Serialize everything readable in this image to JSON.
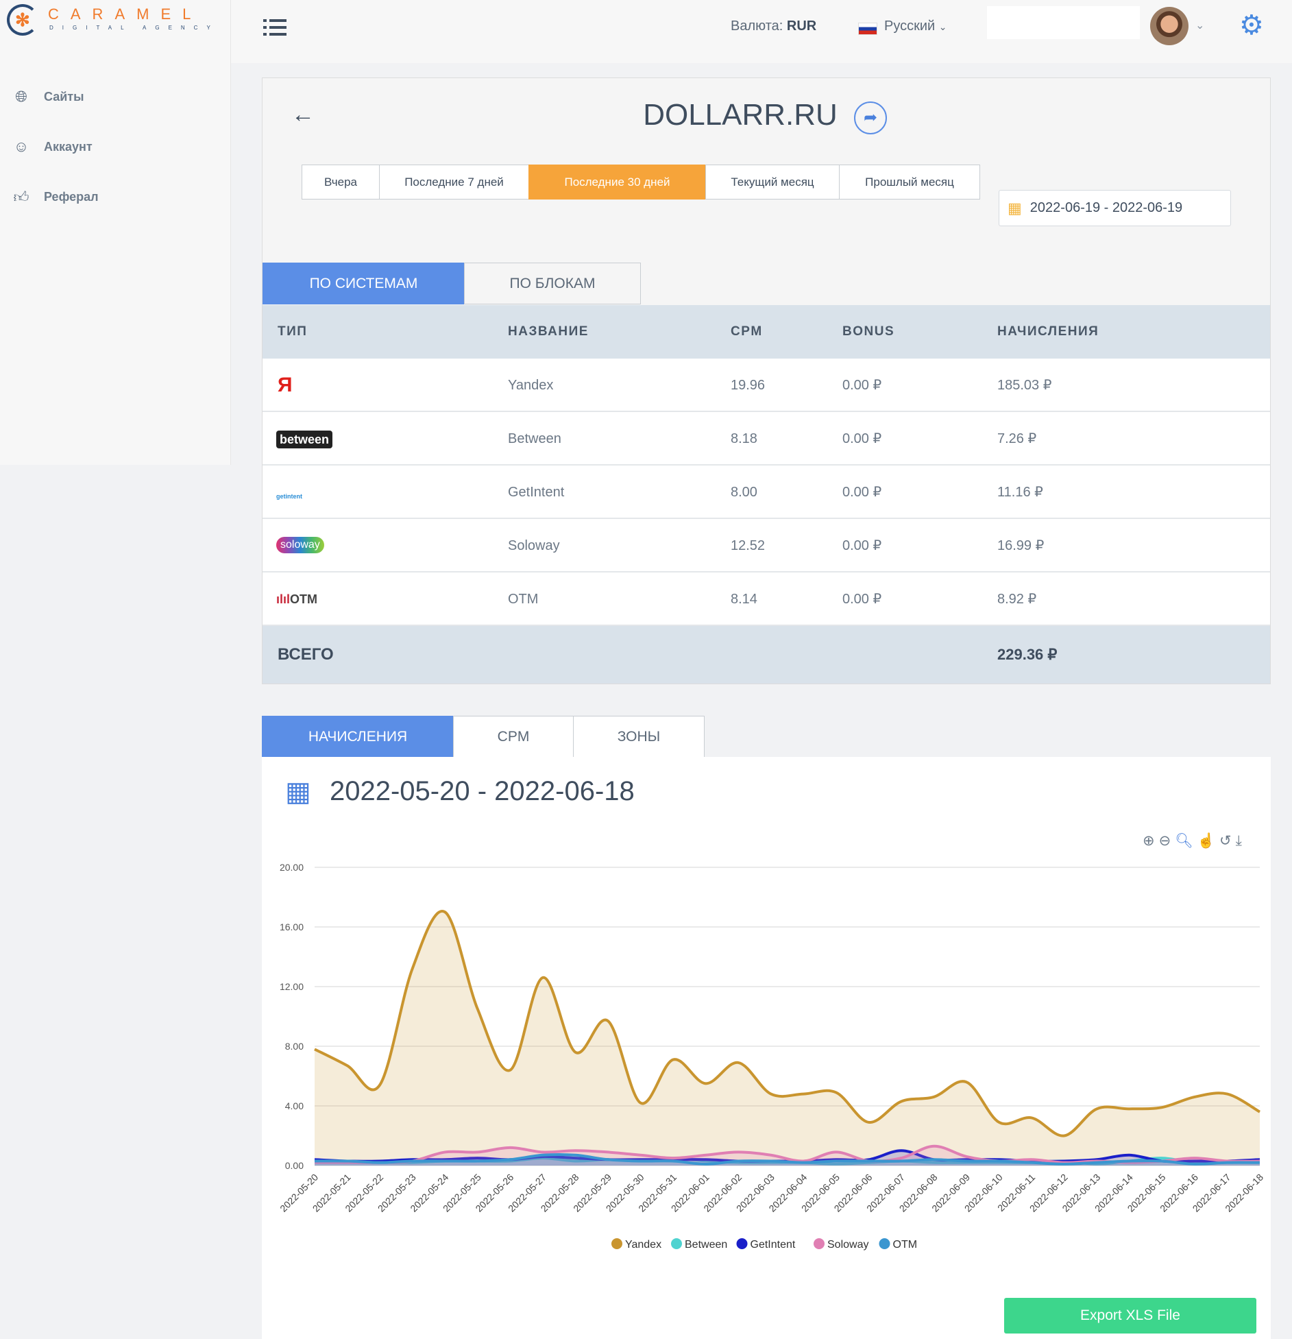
{
  "brand": {
    "name": "CARAMEL",
    "tagline": "DIGITAL AGENCY"
  },
  "sidebar": {
    "items": [
      {
        "label": "Сайты",
        "icon": "globe-icon"
      },
      {
        "label": "Аккаунт",
        "icon": "user-icon"
      },
      {
        "label": "Реферал",
        "icon": "referral-icon"
      }
    ]
  },
  "header": {
    "currency_label": "Валюта:",
    "currency": "RUR",
    "language": "Русский"
  },
  "site": {
    "title": "DOLLARR.RU"
  },
  "periods": [
    {
      "label": "Вчера"
    },
    {
      "label": "Последние 7 дней"
    },
    {
      "label": "Последние 30 дней",
      "active": true
    },
    {
      "label": "Текущий месяц"
    },
    {
      "label": "Прошлый месяц"
    }
  ],
  "date_range": "2022-06-19 - 2022-06-19",
  "view_tabs": [
    "ПО СИСТЕМАМ",
    "ПО БЛОКАМ"
  ],
  "table": {
    "headers": [
      "ТИП",
      "НАЗВАНИЕ",
      "CPM",
      "BONUS",
      "НАЧИСЛЕНИЯ"
    ],
    "rows": [
      {
        "logo": "Я",
        "name": "Yandex",
        "cpm": "19.96",
        "bonus": "0.00 ₽",
        "earn": "185.03 ₽"
      },
      {
        "logo": "between",
        "name": "Between",
        "cpm": "8.18",
        "bonus": "0.00 ₽",
        "earn": "7.26 ₽"
      },
      {
        "logo": "getintent",
        "name": "GetIntent",
        "cpm": "8.00",
        "bonus": "0.00 ₽",
        "earn": "11.16 ₽"
      },
      {
        "logo": "soloway",
        "name": "Soloway",
        "cpm": "12.52",
        "bonus": "0.00 ₽",
        "earn": "16.99 ₽"
      },
      {
        "logo": "OTM",
        "name": "OTM",
        "cpm": "8.14",
        "bonus": "0.00 ₽",
        "earn": "8.92 ₽"
      }
    ],
    "total_label": "ВСЕГО",
    "total": "229.36 ₽"
  },
  "chart_tabs": [
    "НАЧИСЛЕНИЯ",
    "CPM",
    "ЗОНЫ"
  ],
  "chart_range": "2022-05-20 - 2022-06-18",
  "export_label": "Export XLS File",
  "chart_data": {
    "type": "area",
    "x": [
      "2022-05-20",
      "2022-05-21",
      "2022-05-22",
      "2022-05-23",
      "2022-05-24",
      "2022-05-25",
      "2022-05-26",
      "2022-05-27",
      "2022-05-28",
      "2022-05-29",
      "2022-05-30",
      "2022-05-31",
      "2022-06-01",
      "2022-06-02",
      "2022-06-03",
      "2022-06-04",
      "2022-06-05",
      "2022-06-06",
      "2022-06-07",
      "2022-06-08",
      "2022-06-09",
      "2022-06-10",
      "2022-06-11",
      "2022-06-12",
      "2022-06-13",
      "2022-06-14",
      "2022-06-15",
      "2022-06-16",
      "2022-06-17",
      "2022-06-18"
    ],
    "ylim": [
      0,
      20
    ],
    "yticks": [
      "0.00",
      "4.00",
      "8.00",
      "12.00",
      "16.00",
      "20.00"
    ],
    "legend_position": "bottom",
    "series": [
      {
        "name": "Yandex",
        "color": "#c9952f",
        "values": [
          7.8,
          6.7,
          5.4,
          13.2,
          17.0,
          10.5,
          6.4,
          12.6,
          7.6,
          9.7,
          4.2,
          7.1,
          5.5,
          6.9,
          4.8,
          4.8,
          4.9,
          2.9,
          4.3,
          4.6,
          5.6,
          2.9,
          3.2,
          2.0,
          3.8,
          3.8,
          3.9,
          4.6,
          4.8,
          3.6
        ]
      },
      {
        "name": "Between",
        "color": "#4fd3d0",
        "values": [
          0.2,
          0.2,
          0.2,
          0.2,
          0.3,
          0.3,
          0.3,
          0.5,
          0.3,
          0.4,
          0.3,
          0.5,
          0.3,
          0.2,
          0.2,
          0.2,
          0.1,
          0.2,
          0.3,
          0.2,
          0.2,
          0.2,
          0.2,
          0.3,
          0.1,
          0.3,
          0.5,
          0.2,
          0.2,
          0.2
        ]
      },
      {
        "name": "GetIntent",
        "color": "#1a1fc9",
        "values": [
          0.4,
          0.3,
          0.3,
          0.4,
          0.4,
          0.5,
          0.4,
          0.6,
          0.5,
          0.4,
          0.4,
          0.4,
          0.4,
          0.3,
          0.3,
          0.3,
          0.4,
          0.4,
          1.0,
          0.4,
          0.4,
          0.4,
          0.3,
          0.3,
          0.4,
          0.7,
          0.3,
          0.3,
          0.3,
          0.4
        ]
      },
      {
        "name": "Soloway",
        "color": "#e07fb3",
        "values": [
          0.2,
          0.2,
          0.2,
          0.3,
          0.9,
          0.9,
          1.2,
          0.9,
          1.0,
          0.9,
          0.7,
          0.5,
          0.7,
          0.9,
          0.7,
          0.3,
          0.9,
          0.3,
          0.5,
          1.3,
          0.6,
          0.3,
          0.4,
          0.2,
          0.3,
          0.2,
          0.3,
          0.5,
          0.3,
          0.3
        ]
      },
      {
        "name": "OTM",
        "color": "#3a96d0",
        "values": [
          0.3,
          0.3,
          0.2,
          0.3,
          0.3,
          0.3,
          0.4,
          0.7,
          0.7,
          0.4,
          0.3,
          0.3,
          0.1,
          0.3,
          0.3,
          0.2,
          0.3,
          0.3,
          0.3,
          0.4,
          0.3,
          0.3,
          0.2,
          0.1,
          0.2,
          0.3,
          0.3,
          0.1,
          0.2,
          0.2
        ]
      }
    ]
  }
}
